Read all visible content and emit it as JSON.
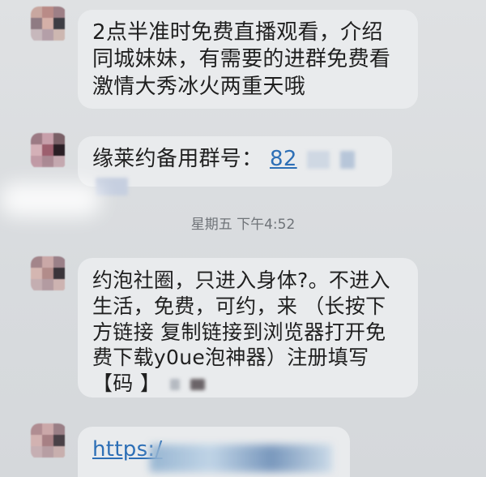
{
  "messages": [
    {
      "text": "2点半准时免费直播观看，介绍同城妹妹，有需要的进群免费看激情大秀冰火两重天哦"
    },
    {
      "prefix": "缘莱约备用群号：",
      "group_number_visible": "82"
    },
    {
      "text": "约泡社圈，只进入身体?。不进入生活，免费，可约，来 （长按下方链接 复制链接到浏览器打开免费下载y0ue泡神器）注册填写",
      "code_label": "【码 】"
    },
    {
      "link_visible": "https:/"
    }
  ],
  "timestamp": "星期五 下午4:52",
  "colors": {
    "background": "#d9dcdf",
    "bubble": "#e9ebed",
    "link": "#2d6fb6",
    "timestamp": "#6f7378"
  }
}
